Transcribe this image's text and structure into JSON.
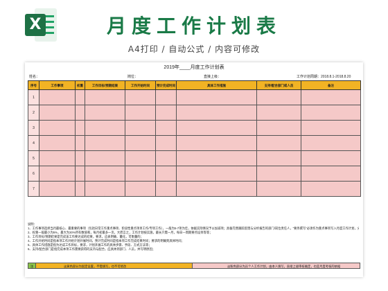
{
  "header": {
    "logo_letter": "X",
    "title": "月度工作计划表",
    "subtitle": "A4打印 / 自动公式 / 内容可修改"
  },
  "form": {
    "title": "2019年____月度工作计划表",
    "name_label": "姓名：",
    "position_label": "岗位：",
    "superior_label": "直接上级：",
    "period_label": "工作计划周期：2018.8.1-2018.8.20"
  },
  "table": {
    "headers": [
      "序号",
      "工作事项",
      "权重",
      "工作目标/预期结果",
      "工作开始时间",
      "预计完成时间",
      "具体工作措施",
      "支持/配合部门或人员",
      "备注"
    ],
    "rows": [
      "1",
      "2",
      "3",
      "4",
      "5",
      "6",
      "7"
    ]
  },
  "notes": {
    "heading": "说明：",
    "lines": [
      "1、工作事项选择当月最核心、最重要的事项（包括日常工作重点事项、阶段性重点项目工作/专项工作），一般为5-7项为佳，依据实际情况予以加减项；具备完善跟踪反馈与分析报告的部门/岗位责任人，“要务撰写”必须作为重点事项写入月度工作计划，分析报告列明要点。",
      "2、权重一般最小为5%，最大为30%所有数值和，每月初最多一页，大而言之，工作计划按实施，最长只需一月，每日一周期要点设目等等；",
      "3、工作目标/预期结果是完成该工作要达成的结果，要求，应表明确、量化，可衡量的；",
      "4、工作开始时间是指本项工作开始计划开展时间，预计完成时间是指本项工作完成结果时间；要求的明确到具体时间；",
      "5、具体工作措施是指为达成工作目标，要求，计划开展工作的具体步骤、手段、方式方法等；",
      "6、支持/配合部门是指完成本项工作需要获得的支持与配合，应具体到部门、人员，并写明原因；"
    ]
  },
  "legend": {
    "key": "注",
    "yellow_text": "淡黄色部分为固定设置，不需填写，也不可修改",
    "pink_text": "淡粉色部分为员个人工作计划，由本人填写，直接上级审核确定，也是月度考核的依据"
  },
  "colors": {
    "header_row": "#f2b324",
    "data_cell": "#f5c9c8",
    "brand_green": "#1e7145",
    "title_green": "#1a7a47"
  }
}
